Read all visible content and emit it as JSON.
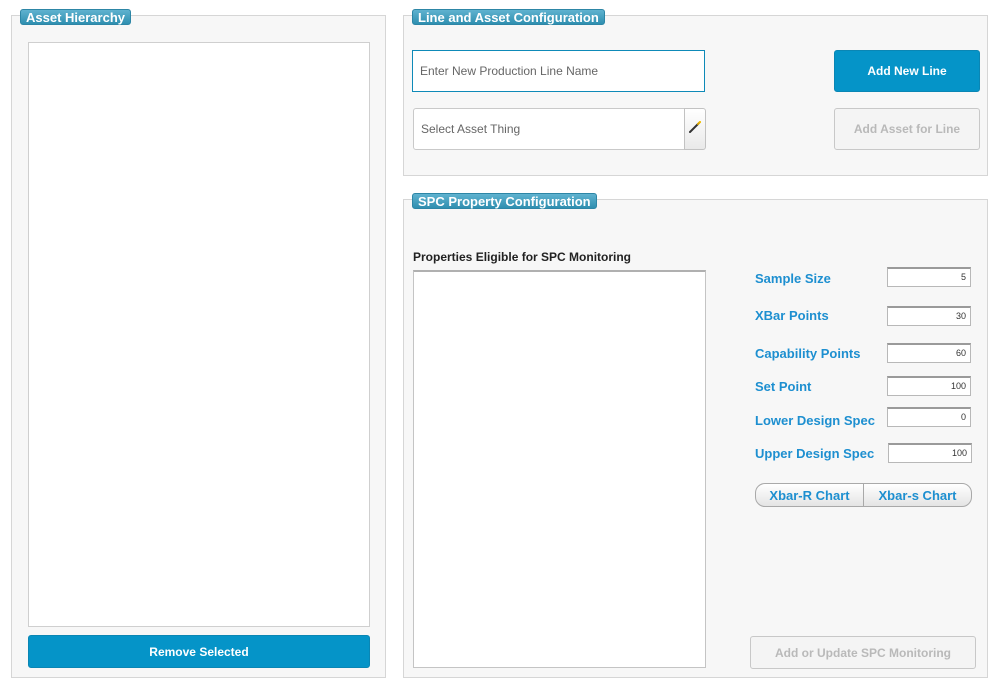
{
  "asset_hierarchy": {
    "title": "Asset Hierarchy",
    "remove_button": "Remove Selected"
  },
  "line_config": {
    "title": "Line and Asset Configuration",
    "line_name_placeholder": "Enter New Production Line Name",
    "add_line_button": "Add New Line",
    "asset_select_placeholder": "Select Asset Thing",
    "add_asset_button": "Add Asset for Line"
  },
  "spc_config": {
    "title": "SPC Property Configuration",
    "eligible_heading": "Properties Eligible for SPC Monitoring",
    "fields": [
      {
        "label": "Sample Size",
        "value": "5"
      },
      {
        "label": "XBar Points",
        "value": "30"
      },
      {
        "label": "Capability Points",
        "value": "60"
      },
      {
        "label": "Set Point",
        "value": "100"
      },
      {
        "label": "Lower Design Spec",
        "value": "0"
      },
      {
        "label": "Upper Design Spec",
        "value": "100"
      }
    ],
    "chart_buttons": [
      "Xbar-R Chart",
      "Xbar-s Chart"
    ],
    "submit_button": "Add or Update SPC Monitoring"
  },
  "icons": {
    "asset_picker": "magic-wand-icon"
  },
  "colors": {
    "accent": "#0594c8",
    "label": "#1d8fd0",
    "legend": "#3b9dbf"
  }
}
